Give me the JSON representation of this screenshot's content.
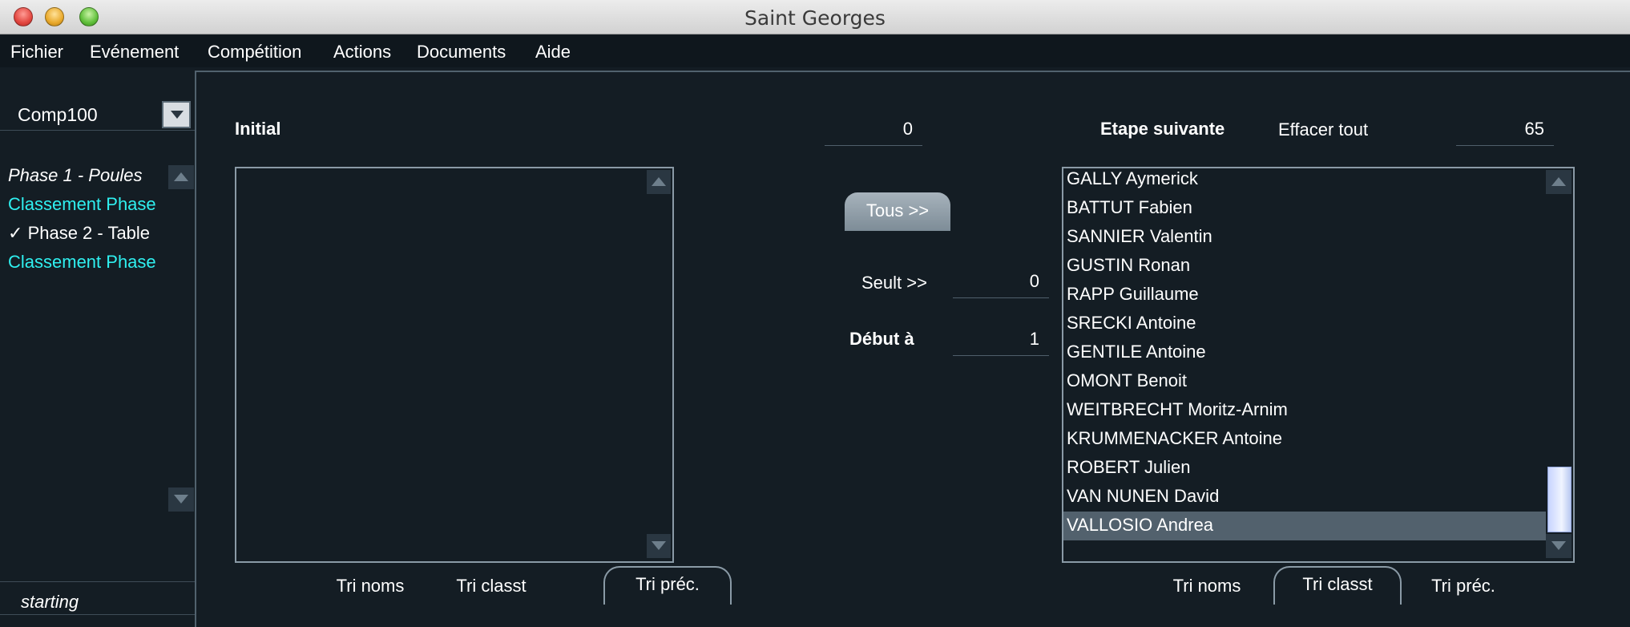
{
  "window": {
    "title": "Saint Georges"
  },
  "menu": [
    "Fichier",
    "Evénement",
    "Compétition",
    "Actions",
    "Documents",
    "Aide"
  ],
  "sidebar": {
    "competition": "Comp100",
    "phases": [
      {
        "label": "Phase 1 - Poules",
        "style": "italic"
      },
      {
        "label": "Classement Phase",
        "style": "cyan"
      },
      {
        "label": "Phase 2 - Table",
        "style": "checked"
      },
      {
        "label": "Classement Phase",
        "style": "cyan"
      }
    ],
    "checkmark": "✓",
    "status": "starting"
  },
  "main": {
    "initial_label": "Initial",
    "initial_count": "0",
    "next_stage_label": "Etape suivante",
    "clear_all_label": "Effacer tout",
    "next_count": "65",
    "all_button": "Tous >>",
    "threshold_label": "Seult >>",
    "threshold_value": "0",
    "start_label": "Début à",
    "start_value": "1",
    "left_tabs": [
      "Tri noms",
      "Tri classt",
      "Tri préc."
    ],
    "right_tabs": [
      "Tri noms",
      "Tri classt",
      "Tri préc."
    ],
    "left_active_tab": 2,
    "right_active_tab": 1,
    "next_list": [
      "GALLY Aymerick",
      "BATTUT Fabien",
      "SANNIER Valentin",
      "GUSTIN Ronan",
      "RAPP Guillaume",
      "SRECKI Antoine",
      "GENTILE Antoine",
      "OMONT Benoit",
      "WEITBRECHT Moritz-Arnim",
      "KRUMMENACKER Antoine",
      "ROBERT Julien",
      "VAN NUNEN David",
      "VALLOSIO Andrea"
    ],
    "selected_index": 12
  },
  "colors": {
    "background": "#141d24",
    "accent_cyan": "#2ff0f0",
    "selection": "#52616d",
    "border": "#8a9aa6"
  }
}
